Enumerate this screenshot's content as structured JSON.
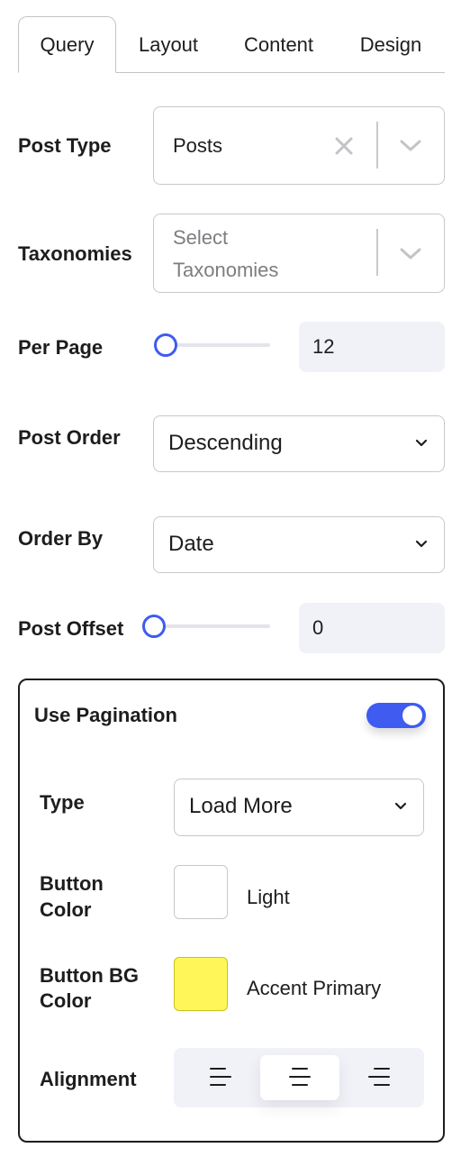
{
  "tabs": [
    {
      "label": "Query",
      "active": true
    },
    {
      "label": "Layout",
      "active": false
    },
    {
      "label": "Content",
      "active": false
    },
    {
      "label": "Design",
      "active": false
    }
  ],
  "post_type": {
    "label": "Post Type",
    "value": "Posts"
  },
  "taxonomies": {
    "label": "Taxonomies",
    "placeholder_line1": "Select",
    "placeholder_line2": "Taxonomies"
  },
  "per_page": {
    "label": "Per Page",
    "value": "12"
  },
  "post_order": {
    "label": "Post Order",
    "value": "Descending"
  },
  "order_by": {
    "label": "Order By",
    "value": "Date"
  },
  "post_offset": {
    "label": "Post Offset",
    "value": "0"
  },
  "pagination": {
    "label": "Use Pagination",
    "enabled": true,
    "type": {
      "label": "Type",
      "value": "Load More"
    },
    "button_color": {
      "label_line1": "Button",
      "label_line2": "Color",
      "value": "Light",
      "swatch": "#ffffff"
    },
    "button_bg_color": {
      "label_line1": "Button BG",
      "label_line2": "Color",
      "value": "Accent Primary",
      "swatch": "#fff75a"
    },
    "alignment": {
      "label": "Alignment",
      "options": [
        "left",
        "center",
        "right"
      ],
      "selected": "center"
    }
  },
  "colors": {
    "accent": "#3f5bf0",
    "border": "#c8c8cc",
    "field_bg": "#f1f2f8"
  }
}
